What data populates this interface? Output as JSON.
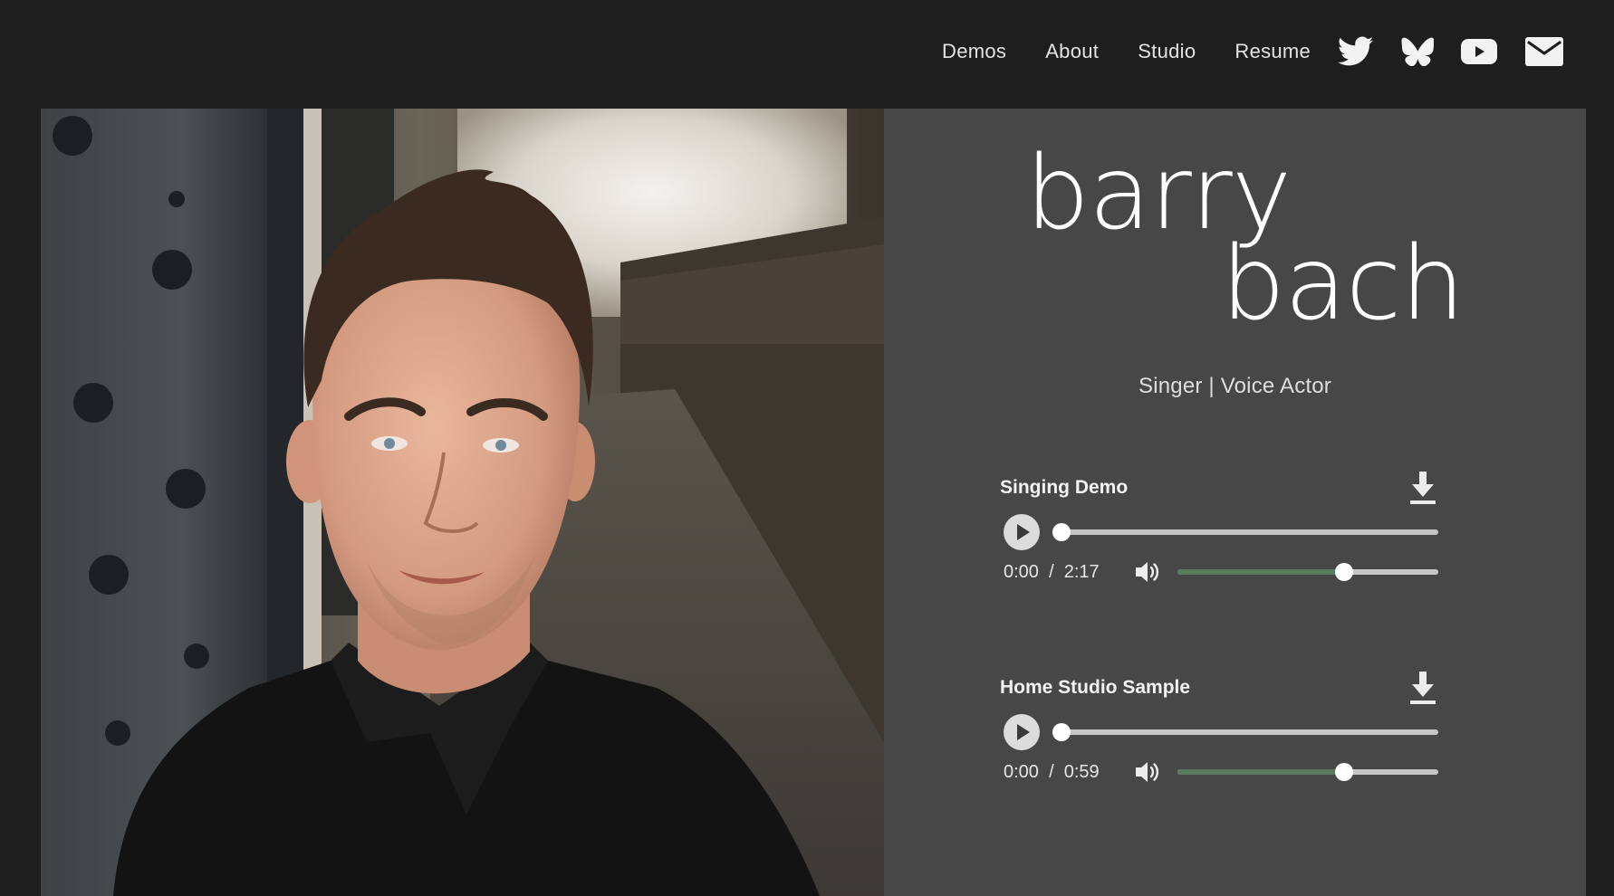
{
  "nav": {
    "items": [
      {
        "label": "Demos"
      },
      {
        "label": "About"
      },
      {
        "label": "Studio"
      },
      {
        "label": "Resume"
      }
    ],
    "socials": [
      {
        "icon": "twitter-icon"
      },
      {
        "icon": "bluesky-icon"
      },
      {
        "icon": "youtube-icon"
      },
      {
        "icon": "mail-icon"
      }
    ]
  },
  "hero": {
    "first_name": "barry",
    "last_name": "bach",
    "tagline": "Singer | Voice Actor"
  },
  "demos": [
    {
      "title": "Singing Demo",
      "current_time": "0:00",
      "separator": "/",
      "duration": "2:17",
      "progress": 0,
      "volume": 0.64
    },
    {
      "title": "Home Studio Sample",
      "current_time": "0:00",
      "separator": "/",
      "duration": "0:59",
      "progress": 0,
      "volume": 0.64
    }
  ],
  "colors": {
    "page_background": "#1e1e1e",
    "panel_background": "#474747",
    "volume_fill": "#5b7b5f",
    "track": "#c6c6c6",
    "text": "#ffffff"
  }
}
